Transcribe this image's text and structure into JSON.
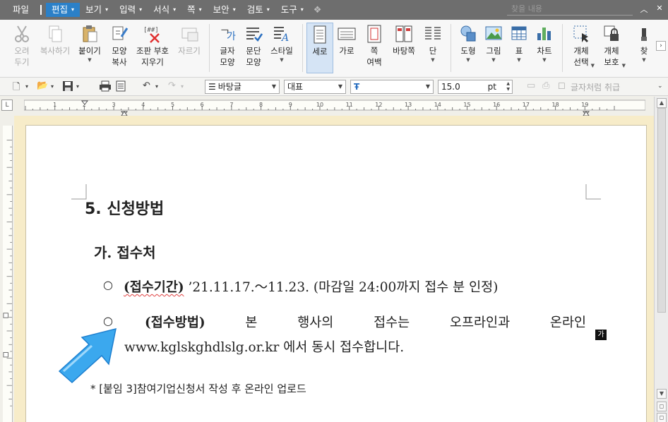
{
  "menubar": {
    "file": "파일",
    "items": [
      {
        "label": "편집",
        "active": true
      },
      {
        "label": "보기"
      },
      {
        "label": "입력"
      },
      {
        "label": "서식"
      },
      {
        "label": "쪽"
      },
      {
        "label": "보안"
      },
      {
        "label": "검토"
      },
      {
        "label": "도구"
      }
    ],
    "search_placeholder": "찾을 내용",
    "accent_color": "#2b80c8"
  },
  "ribbon": {
    "cut": "오려\n두기",
    "copy": "복사하기",
    "paste": "붙이기",
    "format_copy": "모양\n복사",
    "combine": "조판 부호\n지우기",
    "paste_special": "자르기",
    "char_shape": "글자\n모양",
    "para_shape": "문단\n모양",
    "style": "스타일",
    "portrait": "세로",
    "landscape": "가로",
    "page_margin": "쪽\n여백",
    "page_bg": "바탕쪽",
    "columns": "단",
    "shapes": "도형",
    "picture": "그림",
    "table": "표",
    "chart": "차트",
    "obj_select": "개체\n선택",
    "obj_protect": "개체\n보호",
    "find": "찾"
  },
  "toolbar": {
    "style_combo": "바탕글",
    "font_lang": "대표",
    "font_combo": "",
    "font_size": "15.0",
    "unit": "pt",
    "grid_label": "글자처럼 취급"
  },
  "ruler": {
    "numbers": [
      "1",
      "2",
      "3",
      "4",
      "5",
      "6",
      "7",
      "8",
      "9",
      "10",
      "11",
      "12",
      "13",
      "14",
      "15",
      "16",
      "17",
      "18",
      "19"
    ]
  },
  "document": {
    "heading": "5. 신청방법",
    "subheading": "가. 접수처",
    "bullet1_label": "(접수기간)",
    "bullet1_text": "’21.11.17.～11.23. (마감일 24:00까지 접수 분 인정)",
    "bullet2_label": "(접수방법)",
    "bullet2_words": [
      "본",
      "행사의",
      "접수는",
      "오프라인과",
      "온라인"
    ],
    "bullet2_line2": "www.kglskghdlslg.or.kr 에서 동시 접수합니다.",
    "note": "* [붙임 3]참여기업신청서 작성 후 온라인 업로드",
    "ime_indicator": "가",
    "bullet_symbol": "○"
  },
  "colors": {
    "workspace_bg": "#f7ecc9",
    "arrow_fill": "#3ba8ee"
  }
}
